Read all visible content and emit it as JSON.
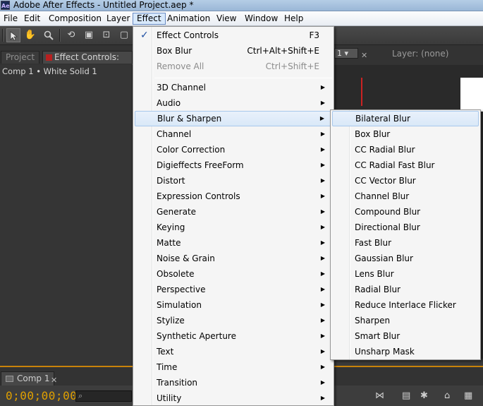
{
  "window": {
    "title": "Adobe After Effects - Untitled Project.aep *",
    "icon_text": "Ae"
  },
  "menubar": [
    "File",
    "Edit",
    "Composition",
    "Layer",
    "Effect",
    "Animation",
    "View",
    "Window",
    "Help"
  ],
  "active_menu": "Effect",
  "panels": {
    "project_tab": "Project",
    "effect_controls_tab": "Effect Controls:",
    "layer_breadcrumb": "Comp 1 • White Solid 1",
    "layer_label": "Layer: (none)",
    "comp_dropdown": "1 ▾",
    "close_glyph": "✕"
  },
  "effect_menu": {
    "top": [
      {
        "label": "Effect Controls",
        "shortcut": "F3",
        "checked": true,
        "check_glyph": "✓"
      },
      {
        "label": "Box Blur",
        "shortcut": "Ctrl+Alt+Shift+E"
      },
      {
        "label": "Remove All",
        "shortcut": "Ctrl+Shift+E",
        "disabled": true
      }
    ],
    "categories": [
      "3D Channel",
      "Audio",
      "Blur & Sharpen",
      "Channel",
      "Color Correction",
      "Digieffects FreeForm",
      "Distort",
      "Expression Controls",
      "Generate",
      "Keying",
      "Matte",
      "Noise & Grain",
      "Obsolete",
      "Perspective",
      "Simulation",
      "Stylize",
      "Synthetic Aperture",
      "Text",
      "Time",
      "Transition",
      "Utility"
    ],
    "highlighted_category": "Blur & Sharpen",
    "arrow_glyph": "▶"
  },
  "blur_submenu": {
    "items": [
      "Bilateral Blur",
      "Box Blur",
      "CC Radial Blur",
      "CC Radial Fast Blur",
      "CC Vector Blur",
      "Channel Blur",
      "Compound Blur",
      "Directional Blur",
      "Fast Blur",
      "Gaussian Blur",
      "Lens Blur",
      "Radial Blur",
      "Reduce Interlace Flicker",
      "Sharpen",
      "Smart Blur",
      "Unsharp Mask"
    ],
    "highlighted": "Bilateral Blur"
  },
  "timeline": {
    "tab": "Comp 1",
    "timecode": "0;00;00;00",
    "close_glyph": "✕"
  },
  "icons": {
    "selection_tool": "selection-tool-icon",
    "hand_tool": "hand-tool-icon",
    "zoom_tool": "zoom-tool-icon",
    "search": "search-icon"
  }
}
